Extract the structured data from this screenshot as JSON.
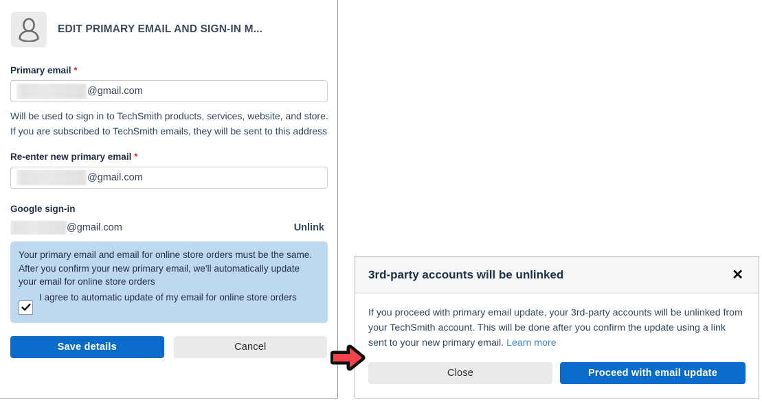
{
  "panel": {
    "icon": "person-avatar-icon",
    "title": "EDIT PRIMARY EMAIL AND SIGN-IN M...",
    "primary_email": {
      "label": "Primary email",
      "required_marker": "*",
      "value_domain": "@gmail.com",
      "redacted": true
    },
    "helper_text": "Will be used to sign in to TechSmith products, services, website, and store. If you are subscribed to TechSmith emails, they will be sent to this address",
    "reenter_email": {
      "label": "Re-enter new primary email",
      "required_marker": "*",
      "value_domain": "@gmail.com",
      "redacted": true
    },
    "google_signin": {
      "label": "Google sign-in",
      "account_domain": "@gmail.com",
      "unlink_label": "Unlink"
    },
    "notice": {
      "text": "Your primary email and email for online store orders must be the same. After you confirm your new primary email, we'll automatically update your email for online store orders",
      "checkbox_label": "I agree to automatic update of my email for online store orders",
      "checkbox_checked": true,
      "background_color": "#bed9ef"
    },
    "footer": {
      "save_label": "Save details",
      "cancel_label": "Cancel"
    }
  },
  "dialog": {
    "title": "3rd-party accounts will be unlinked",
    "close_icon": "close-x-icon",
    "body_text": "If you proceed with primary email update, your 3rd-party accounts will be unlinked from your TechSmith account. This will be done after you confirm the update using a link sent to your new primary email.",
    "learn_more_label": "Learn more",
    "footer": {
      "close_label": "Close",
      "proceed_label": "Proceed with email update"
    }
  },
  "cursor": {
    "icon": "red-right-arrow-cursor"
  },
  "colors": {
    "primary_button": "#0b6bcb",
    "secondary_button": "#e9eaeb",
    "notice_background": "#bed9ef",
    "required_asterisk": "#d93025",
    "link": "#3f86c8",
    "cursor_arrow": "#f4434a"
  }
}
